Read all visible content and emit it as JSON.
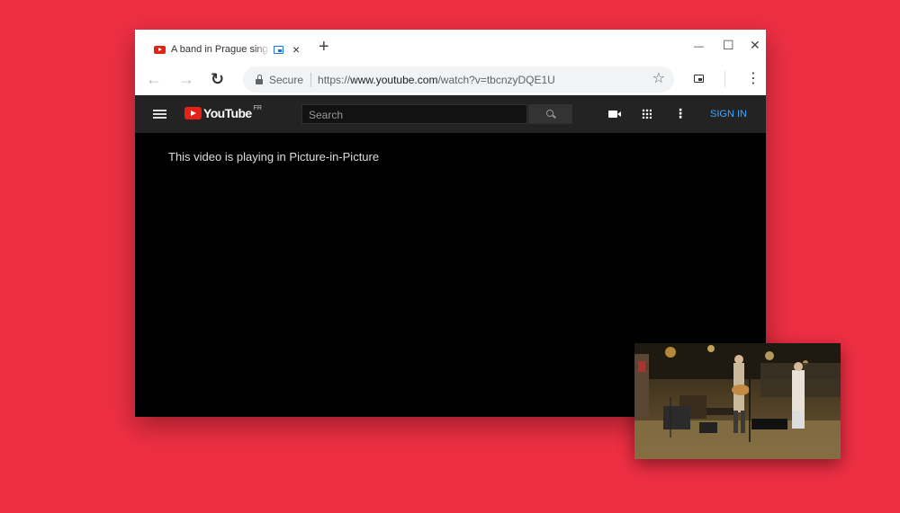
{
  "tab": {
    "title": "A band in Prague sings th",
    "close_glyph": "×",
    "new_tab_glyph": "+"
  },
  "window_controls": {
    "minimize": "—",
    "maximize": "☐",
    "close": "✕"
  },
  "toolbar": {
    "back_glyph": "←",
    "forward_glyph": "→",
    "reload_glyph": "↻",
    "secure_label": "Secure",
    "url_scheme": "https://",
    "url_host": "www.youtube.com",
    "url_path": "/watch?v=tbcnzyDQE1U",
    "star_glyph": "☆",
    "menu_glyph": "⋮"
  },
  "youtube": {
    "logo_text": "YouTube",
    "country_code": "FR",
    "search_placeholder": "Search",
    "menu_glyph": "⋮",
    "sign_in_label": "SIGN IN"
  },
  "player": {
    "pip_message": "This video is playing in Picture-in-Picture"
  },
  "icons": [
    "youtube-favicon",
    "pip-icon",
    "lock-icon",
    "star-icon",
    "hamburger-icon",
    "search-icon",
    "camera-icon",
    "apps-icon"
  ],
  "colors": {
    "background": "#ee2f43",
    "youtube_red": "#e62117",
    "sign_in_blue": "#3ea6ff",
    "masthead": "#232323"
  }
}
